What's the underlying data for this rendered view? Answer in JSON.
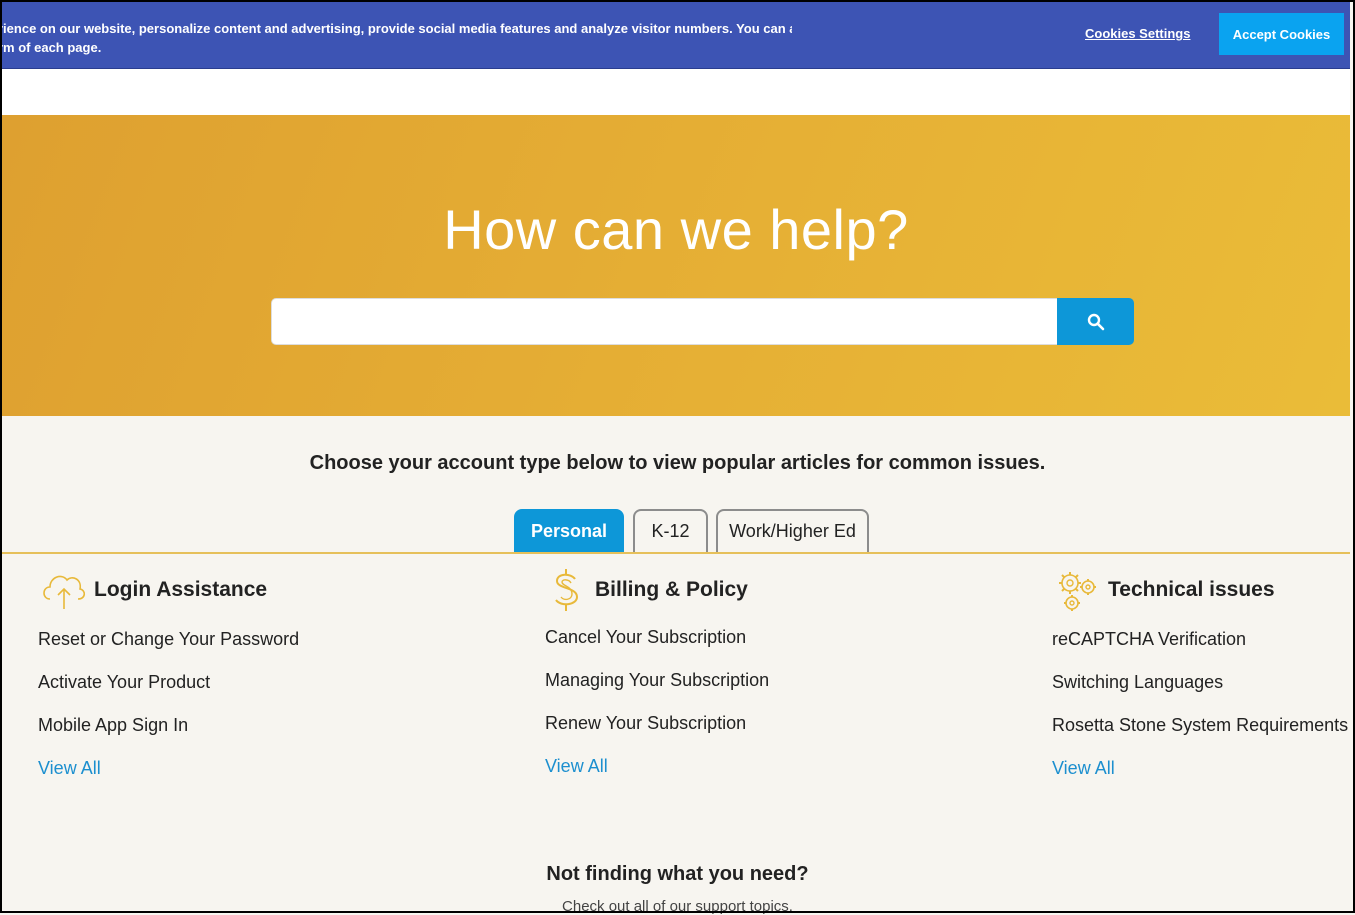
{
  "cookie": {
    "line1": "rience on our website, personalize content and advertising, provide social media features and analyze visitor numbers. You can adjust",
    "line2": "rm of each page.",
    "settings_label": "Cookies Settings",
    "accept_label": "Accept Cookies"
  },
  "hero": {
    "title": "How can we help?",
    "search_placeholder": ""
  },
  "intro": "Choose your account type below to view popular articles for common issues.",
  "tabs": [
    "Personal",
    "K-12",
    "Work/Higher Ed"
  ],
  "columns": [
    {
      "title": "Login Assistance",
      "icon": "cloud-upload-icon",
      "links": [
        "Reset or Change Your Password",
        "Activate Your Product",
        "Mobile App Sign In"
      ],
      "view_all": "View All"
    },
    {
      "title": "Billing & Policy",
      "icon": "dollar-icon",
      "links": [
        "Cancel Your Subscription",
        "Managing Your Subscription",
        "Renew Your Subscription"
      ],
      "view_all": "View All"
    },
    {
      "title": "Technical issues",
      "icon": "gears-icon",
      "links": [
        "reCAPTCHA Verification",
        "Switching Languages",
        "Rosetta Stone System Requirements"
      ],
      "view_all": "View All"
    }
  ],
  "footer": {
    "heading": "Not finding what you need?",
    "subtext": "Check out all of our support topics."
  },
  "colors": {
    "accent": "#0d97d8",
    "banner": "#3d54b4",
    "hero": "#e6b035",
    "icon": "#e8b93a"
  }
}
